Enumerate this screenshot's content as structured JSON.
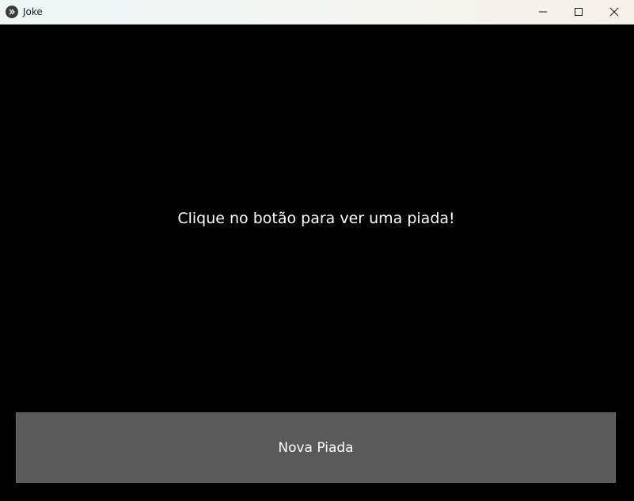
{
  "window": {
    "title": "Joke",
    "app_icon": "kivy-logo-icon",
    "controls": {
      "minimize": "minimize-icon",
      "maximize": "maximize-icon",
      "close": "close-icon"
    }
  },
  "main": {
    "message": "Clique no botão para ver uma piada!",
    "button_label": "Nova Piada"
  },
  "colors": {
    "background": "#000000",
    "button": "#5a5a5a",
    "text": "#ffffff"
  }
}
